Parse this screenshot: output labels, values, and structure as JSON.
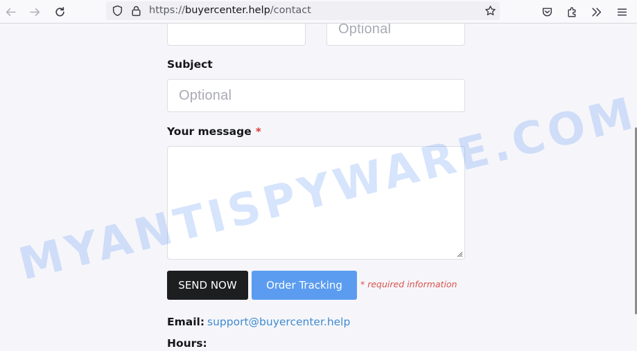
{
  "browser": {
    "url_scheme": "https://",
    "url_host": "buyercenter.help",
    "url_path": "/contact",
    "icons": [
      "back-icon",
      "forward-icon",
      "reload-icon",
      "shield-icon",
      "lock-icon",
      "star-icon",
      "pocket-icon",
      "extensions-icon",
      "overflow-icon",
      "menu-icon"
    ]
  },
  "form": {
    "top_right_placeholder": "Optional",
    "subject_label": "Subject",
    "subject_placeholder": "Optional",
    "message_label": "Your message",
    "required_marker": "*",
    "send_label": "SEND NOW",
    "tracking_label": "Order Tracking",
    "required_note": "* required information"
  },
  "contact": {
    "email_label": "Email:",
    "email_value": "support@buyercenter.help",
    "hours_label": "Hours:"
  },
  "watermark": "MYANTISPYWARE.COM",
  "colors": {
    "send_button": "#1d1e20",
    "tracking_button": "#5b9cf0",
    "required": "#e03a3a",
    "link": "#3f8ad1"
  }
}
